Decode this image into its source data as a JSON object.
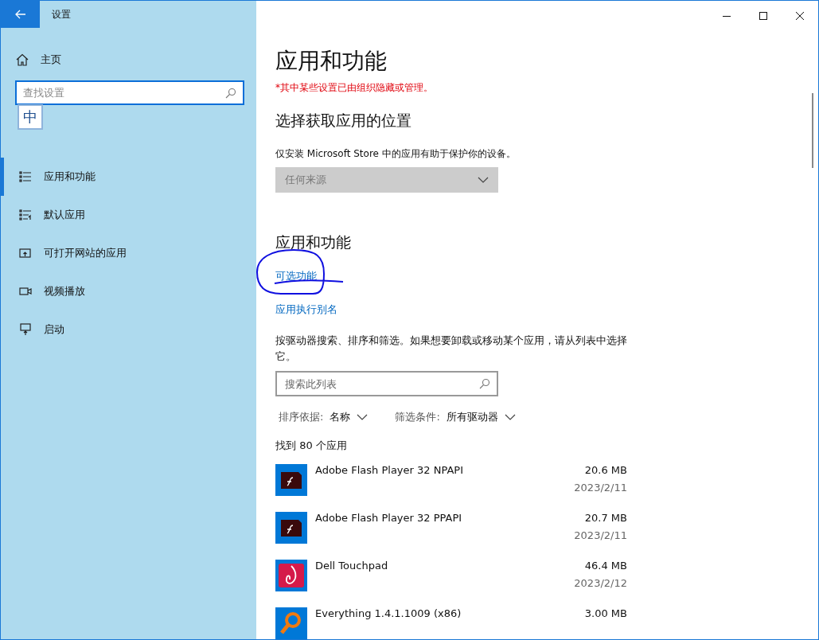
{
  "window": {
    "title": "设置"
  },
  "sidebar": {
    "home": "主页",
    "search": {
      "placeholder": "查找设置"
    },
    "ime_indicator": "中",
    "items": [
      {
        "label": "应用和功能",
        "kind": "list",
        "selected": true
      },
      {
        "label": "默认应用",
        "kind": "default",
        "selected": false
      },
      {
        "label": "可打开网站的应用",
        "kind": "web",
        "selected": false
      },
      {
        "label": "视频播放",
        "kind": "video",
        "selected": false
      },
      {
        "label": "启动",
        "kind": "startup",
        "selected": false
      }
    ]
  },
  "main": {
    "title": "应用和功能",
    "policy_notice": "*其中某些设置已由组织隐藏或管理。",
    "source_heading": "选择获取应用的位置",
    "source_description": "仅安装 Microsoft Store 中的应用有助于保护你的设备。",
    "source_dropdown": {
      "value": "任何来源",
      "disabled": true
    },
    "apps_heading": "应用和功能",
    "links": [
      {
        "label": "可选功能",
        "annotated": true
      },
      {
        "label": "应用执行别名",
        "annotated": false
      }
    ],
    "list_description": "按驱动器搜索、排序和筛选。如果想要卸载或移动某个应用，请从列表中选择它。",
    "list_search": {
      "placeholder": "搜索此列表"
    },
    "sort": {
      "label": "排序依据:",
      "value": "名称"
    },
    "filter": {
      "label": "筛选条件:",
      "value": "所有驱动器"
    },
    "count": "找到 80 个应用",
    "apps": [
      {
        "name": "Adobe Flash Player 32 NPAPI",
        "size": "20.6 MB",
        "date": "2023/2/11",
        "kind": "flash"
      },
      {
        "name": "Adobe Flash Player 32 PPAPI",
        "size": "20.7 MB",
        "date": "2023/2/11",
        "kind": "flash"
      },
      {
        "name": "Dell Touchpad",
        "size": "46.4 MB",
        "date": "2023/2/12",
        "kind": "dell"
      },
      {
        "name": "Everything 1.4.1.1009 (x86)",
        "size": "3.00 MB",
        "kind": "everything"
      }
    ]
  }
}
